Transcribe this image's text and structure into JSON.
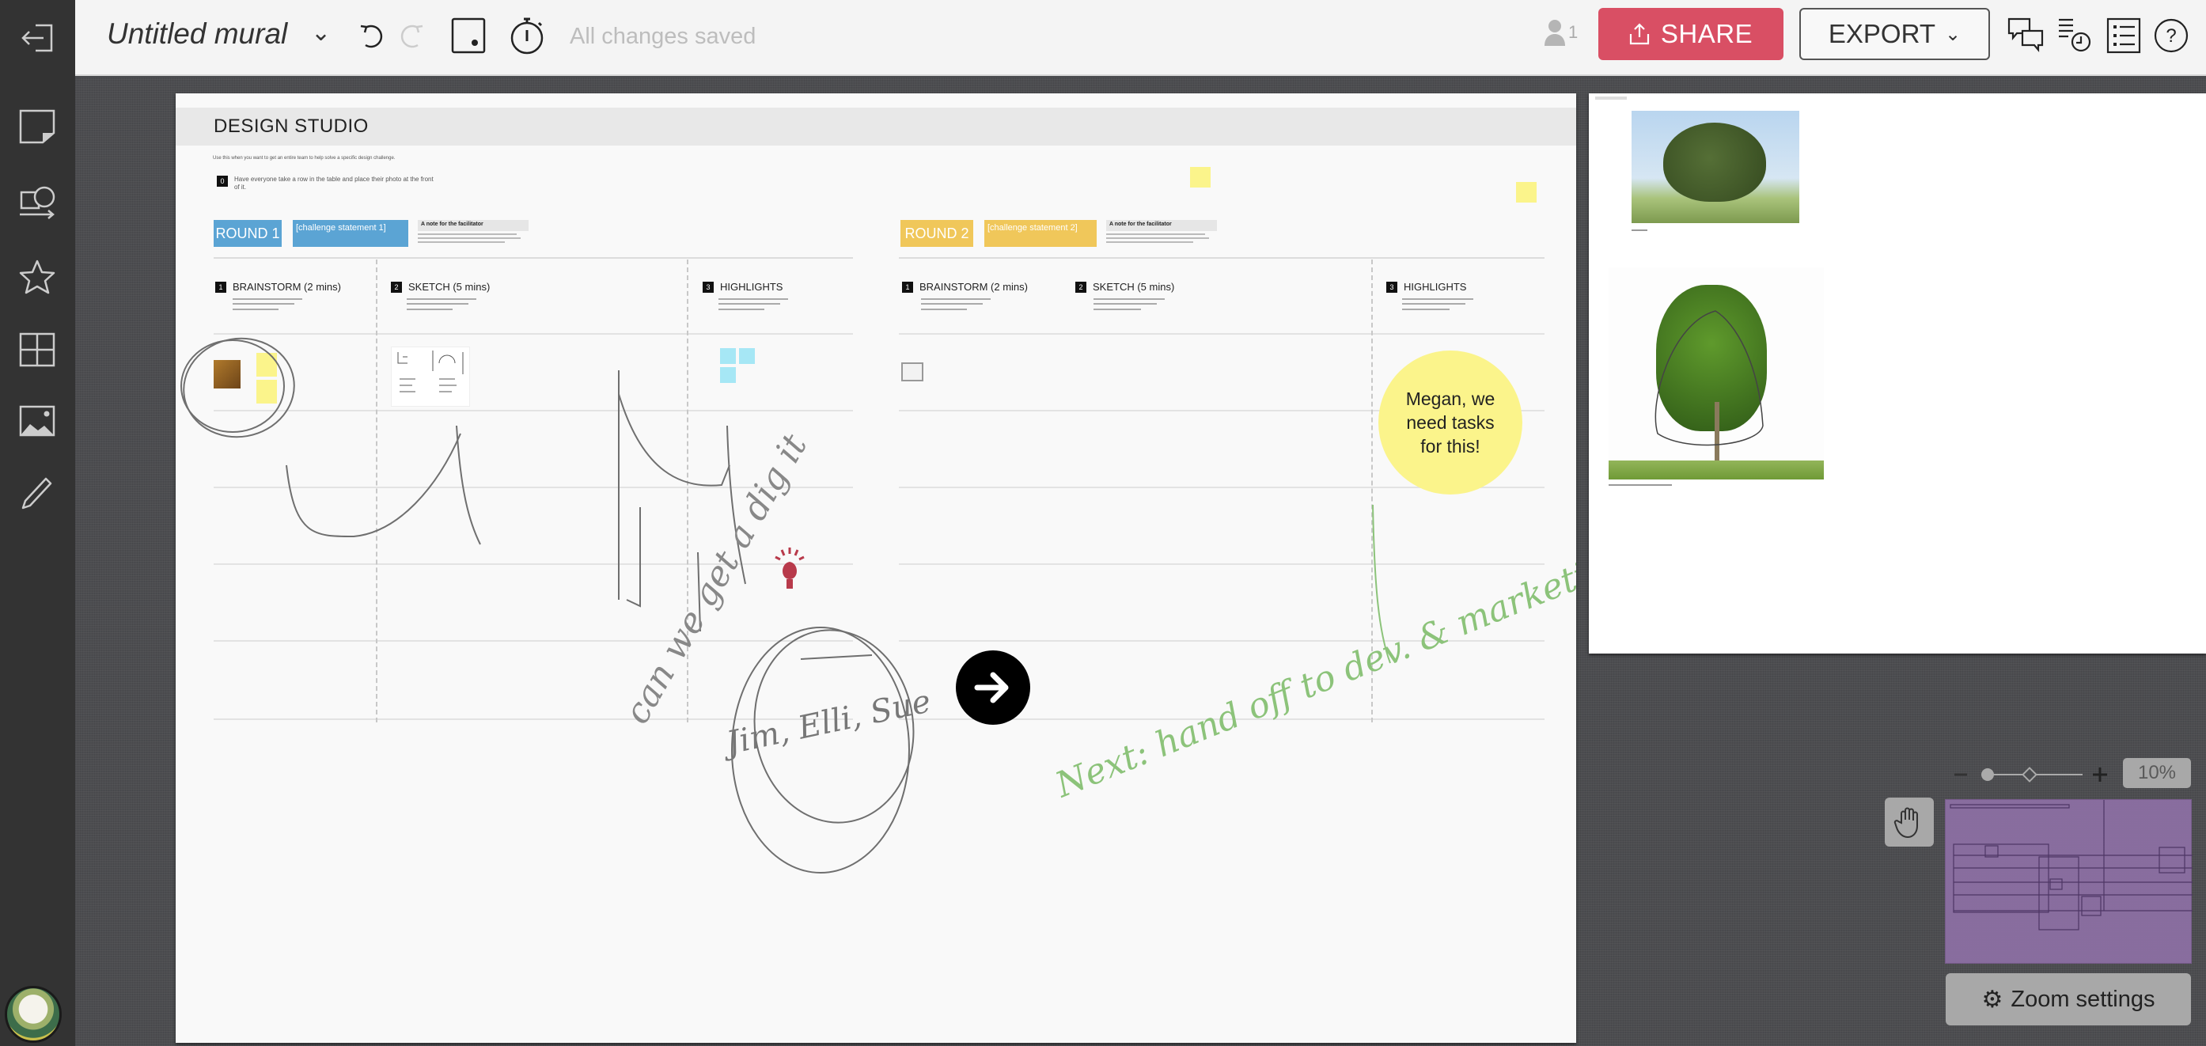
{
  "app": {
    "title": "Untitled mural",
    "status": "All changes saved",
    "user_count": "1",
    "share_label": "SHARE",
    "export_label": "EXPORT"
  },
  "sidebar": {
    "items": [
      {
        "name": "sticky-note",
        "label": "Sticky note"
      },
      {
        "name": "shapes",
        "label": "Shapes and connectors"
      },
      {
        "name": "icons",
        "label": "Icons"
      },
      {
        "name": "frameworks",
        "label": "Frameworks"
      },
      {
        "name": "images",
        "label": "Images"
      },
      {
        "name": "draw",
        "label": "Draw"
      }
    ]
  },
  "mural": {
    "title": "DESIGN STUDIO",
    "intro": "Use this when you want to get an entire team to help solve a specific design challenge.",
    "step0": "Have everyone take a row in the table and place their photo at the front of it.",
    "rounds": [
      {
        "label": "ROUND 1",
        "challenge": "[challenge statement 1]",
        "color": "#5ba4d4",
        "facilitator_title": "A note for the facilitator",
        "sections": [
          {
            "num": "1",
            "title": "BRAINSTORM (2 mins)"
          },
          {
            "num": "2",
            "title": "SKETCH (5 mins)"
          },
          {
            "num": "3",
            "title": "HIGHLIGHTS"
          }
        ]
      },
      {
        "label": "ROUND 2",
        "challenge": "[challenge statement 2]",
        "color": "#f0c75a",
        "facilitator_title": "A note for the facilitator",
        "sections": [
          {
            "num": "1",
            "title": "BRAINSTORM (2 mins)"
          },
          {
            "num": "2",
            "title": "SKETCH (5 mins)"
          },
          {
            "num": "3",
            "title": "HIGHLIGHTS"
          }
        ]
      }
    ],
    "circle_note": "Megan, we need tasks for this!",
    "handwriting": {
      "note1": "can we get a dig it",
      "note2": "Jim, Elli, Sue",
      "note3": "Next: hand off to dev. & marketing"
    }
  },
  "zoom": {
    "level": "10%",
    "settings_label": "Zoom settings"
  },
  "colors": {
    "share": "#d94f64",
    "round1": "#5ba4d4",
    "round2": "#f0c75a",
    "sticky": "#fbf48b",
    "highlight_sticky": "#a6e7f5",
    "pen_green": "#7fbf6a",
    "bulb": "#b83a4b"
  }
}
